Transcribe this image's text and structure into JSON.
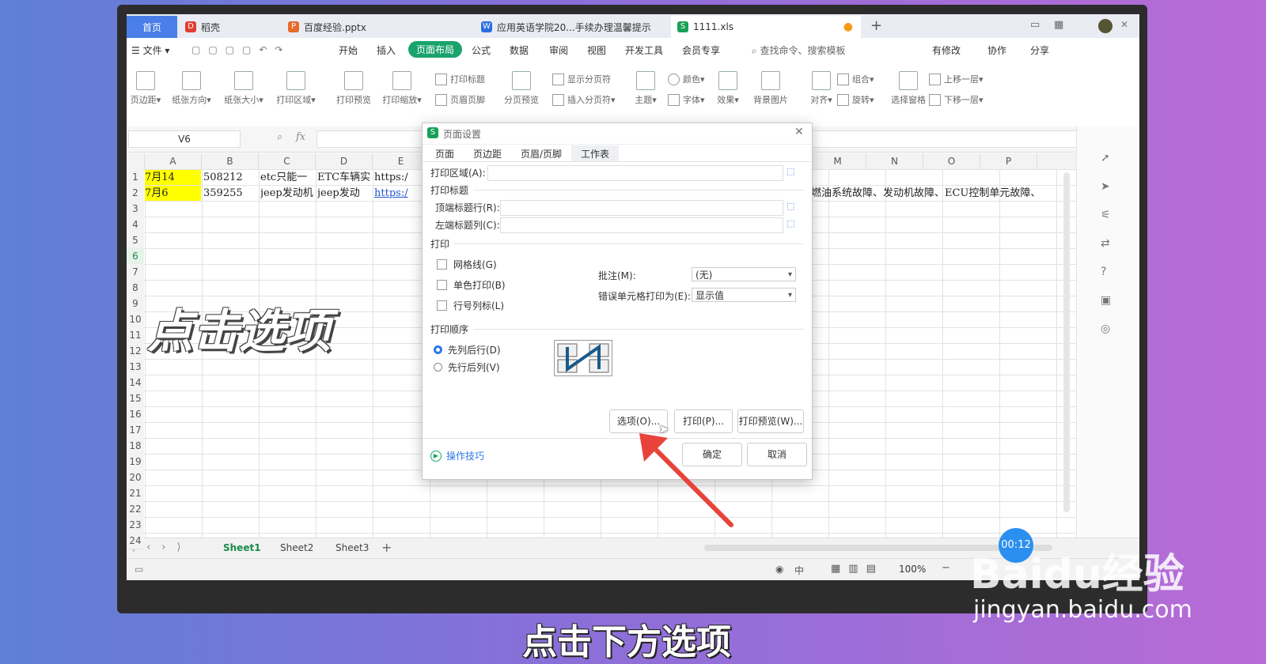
{
  "tabs": [
    {
      "label": "首页"
    },
    {
      "label": "稻壳"
    },
    {
      "label": "百度经验.pptx"
    },
    {
      "label": "应用英语学院20...手续办理温馨提示"
    },
    {
      "label": "1111.xls"
    }
  ],
  "menu": {
    "file": "文件",
    "items": [
      "开始",
      "插入",
      "页面布局",
      "公式",
      "数据",
      "审阅",
      "视图",
      "开发工具",
      "会员专享"
    ],
    "search": "查找命令、搜索模板",
    "right": [
      "有修改",
      "协作",
      "分享"
    ]
  },
  "ribbon": {
    "big": [
      "页边距",
      "纸张方向",
      "纸张大小",
      "打印区域",
      "打印预览",
      "打印缩放",
      "分页预览",
      "主题",
      "效果",
      "背景图片",
      "对齐",
      "选择窗格"
    ],
    "small": [
      "打印标题",
      "页眉页脚",
      "显示分页符",
      "插入分页符",
      "颜色",
      "字体",
      "组合",
      "旋转",
      "上移一层",
      "下移一层"
    ]
  },
  "formula": {
    "namebox": "V6",
    "fx": "fx"
  },
  "columns": [
    "A",
    "B",
    "C",
    "D",
    "E",
    "M",
    "N",
    "O",
    "P"
  ],
  "rows": [
    "1",
    "2",
    "3",
    "4",
    "5",
    "6",
    "7",
    "8",
    "9",
    "10",
    "11",
    "12",
    "13",
    "14",
    "15",
    "16",
    "17",
    "18",
    "19",
    "20",
    "21",
    "22",
    "23",
    "24"
  ],
  "cells": {
    "a1": "7月14",
    "b1": "508212",
    "c1": "etc只能一",
    "d1": "ETC车辆实",
    "e1": "https:/",
    "a2": "7月6",
    "b2": "359255",
    "c2": "jeep发动机",
    "d2": "jeep发动",
    "e2": "https:/",
    "m2": "燃油系统故障、发动机故障、ECU控制单元故障、"
  },
  "sheets": [
    "Sheet1",
    "Sheet2",
    "Sheet3"
  ],
  "status": {
    "zoom": "100%",
    "zh": "中"
  },
  "dialog": {
    "title": "页面设置",
    "tabs": [
      "页面",
      "页边距",
      "页眉/页脚",
      "工作表"
    ],
    "print_area": "打印区域(A):",
    "print_titles": "打印标题",
    "top_rows": "顶端标题行(R):",
    "left_cols": "左端标题列(C):",
    "print_section": "打印",
    "gridlines": "网格线(G)",
    "mono": "单色打印(B)",
    "rowcol": "行号列标(L)",
    "comments_label": "批注(M):",
    "comments_value": "(无)",
    "errors_label": "错误单元格打印为(E):",
    "errors_value": "显示值",
    "order_section": "打印顺序",
    "down_over": "先列后行(D)",
    "over_down": "先行后列(V)",
    "options_btn": "选项(O)...",
    "print_btn": "打印(P)...",
    "preview_btn": "打印预览(W)...",
    "tips": "操作技巧",
    "ok": "确定",
    "cancel": "取消"
  },
  "overlay": {
    "caption_left": "点击选项",
    "subtitle": "点击下方选项",
    "timer": "00:12",
    "watermark_brand": "Baidu经验",
    "watermark_url": "jingyan.baidu.com"
  },
  "colors": {
    "accent": "#1aa36b",
    "highlight": "#ffff00",
    "link": "#2255cc",
    "arrow": "#e8433a"
  }
}
